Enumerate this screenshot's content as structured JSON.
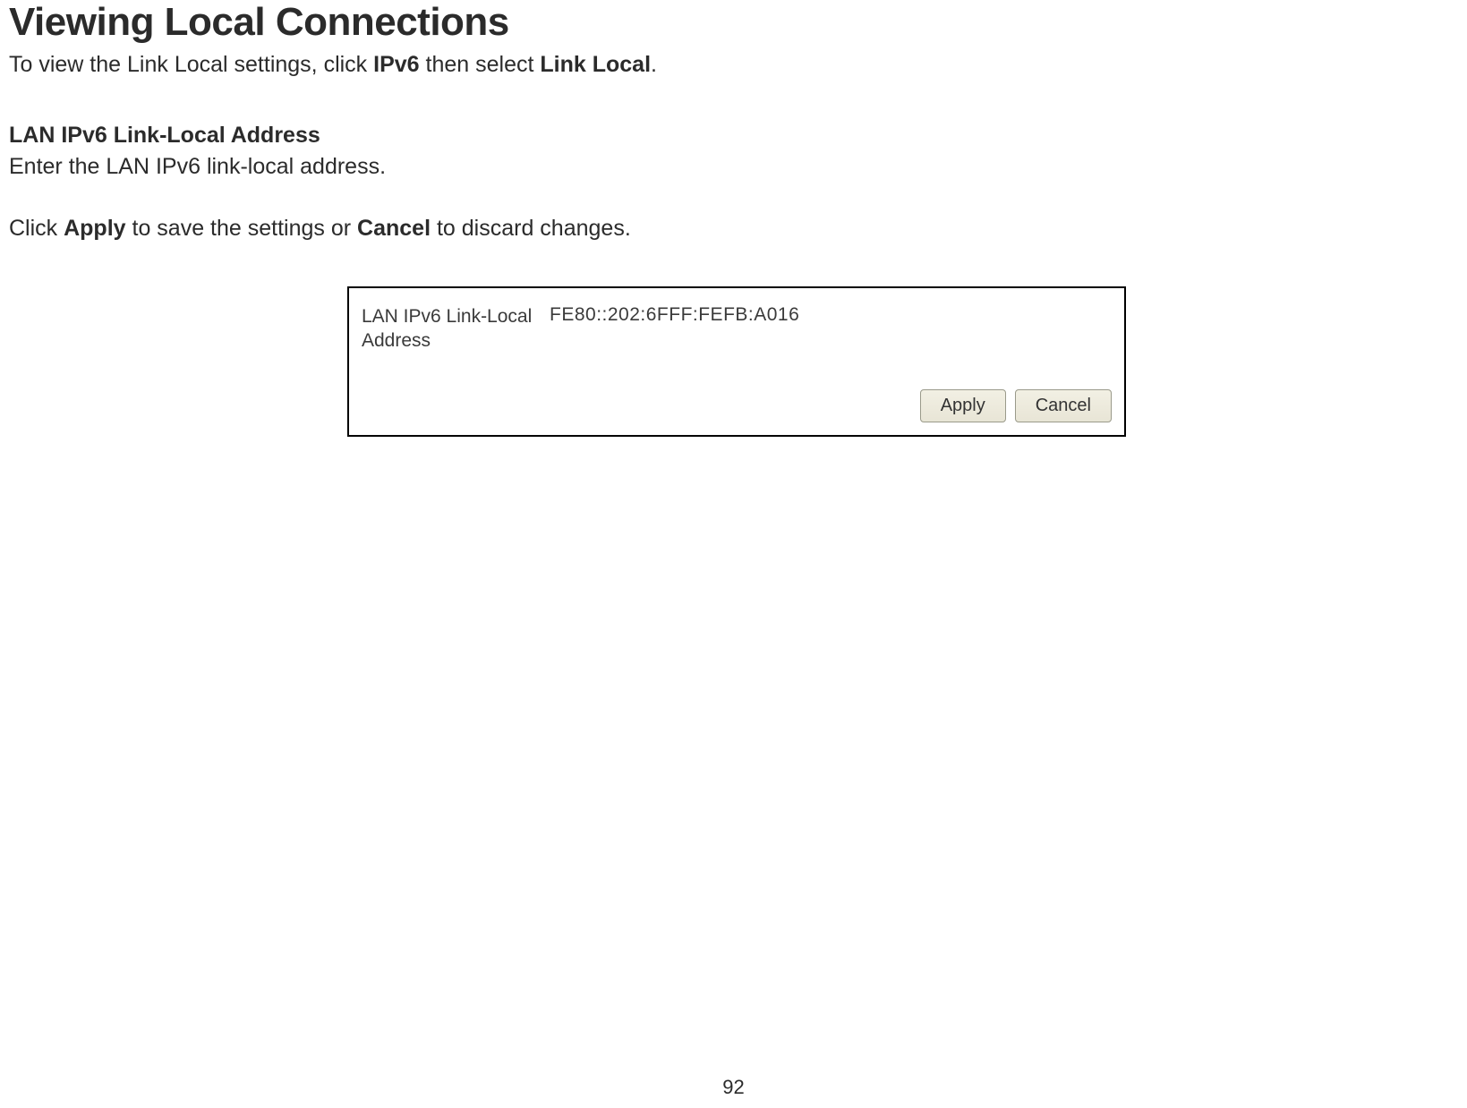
{
  "heading": "Viewing Local Connections",
  "intro": {
    "prefix": "To view the Link Local settings, click ",
    "bold1": "IPv6",
    "mid": " then select ",
    "bold2": "Link Local",
    "suffix": "."
  },
  "subheading": "LAN IPv6 Link-Local Address",
  "body": "Enter the LAN IPv6 link-local address.",
  "instruction": {
    "prefix": "Click ",
    "bold1": "Apply",
    "mid": " to save the settings or ",
    "bold2": "Cancel",
    "suffix": " to discard changes."
  },
  "panel": {
    "label": "LAN IPv6 Link-Local Address",
    "value": "FE80::202:6FFF:FEFB:A016",
    "apply": "Apply",
    "cancel": "Cancel"
  },
  "page_number": "92"
}
